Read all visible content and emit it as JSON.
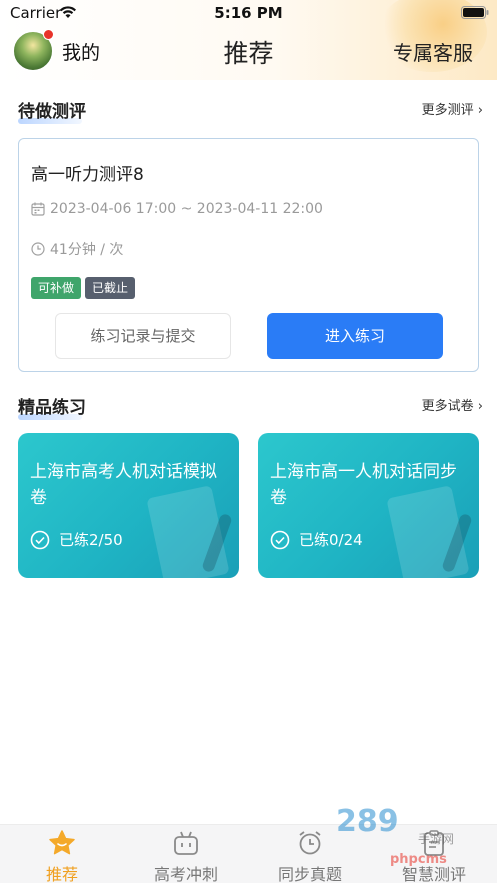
{
  "status_bar": {
    "carrier": "Carrier",
    "time": "5:16 PM"
  },
  "header": {
    "my_label": "我的",
    "title": "推荐",
    "service_label": "专属客服"
  },
  "pending": {
    "section_title": "待做测评",
    "more_label": "更多测评",
    "card": {
      "title": "高一听力测评8",
      "time_range": "2023-04-06 17:00 ~ 2023-04-11 22:00",
      "duration": "41分钟 / 次",
      "tags": [
        "可补做",
        "已截止"
      ],
      "record_button": "练习记录与提交",
      "enter_button": "进入练习"
    }
  },
  "featured": {
    "section_title": "精品练习",
    "more_label": "更多试卷",
    "items": [
      {
        "title": "上海市高考人机对话模拟卷",
        "progress": "已练2/50"
      },
      {
        "title": "上海市高一人机对话同步卷",
        "progress": "已练0/24"
      }
    ]
  },
  "tabbar": {
    "items": [
      {
        "label": "推荐",
        "active": true,
        "icon": "star-icon"
      },
      {
        "label": "高考冲刺",
        "active": false,
        "icon": "tv-robot-icon"
      },
      {
        "label": "同步真题",
        "active": false,
        "icon": "alarm-clock-icon"
      },
      {
        "label": "智慧测评",
        "active": false,
        "icon": "clipboard-icon"
      }
    ]
  },
  "watermark": {
    "logo": "289",
    "sub": "手游网",
    "site": "phpcms"
  },
  "colors": {
    "accent_blue": "#2a7cf6",
    "active_tab": "#f0a020",
    "teal_card": "#1fb4c4",
    "tag_green": "#3fa56b",
    "tag_gray": "#575f6e"
  }
}
